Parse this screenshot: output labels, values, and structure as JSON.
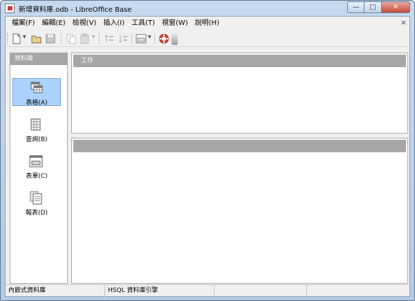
{
  "window": {
    "title": "新增資料庫.odb - LibreOffice Base",
    "minimize_glyph": "—",
    "maximize_glyph": "□",
    "close_glyph": "✕"
  },
  "menubar": {
    "items": [
      "檔案(F)",
      "編輯(E)",
      "檢視(V)",
      "插入(I)",
      "工具(T)",
      "視窗(W)",
      "說明(H)"
    ],
    "close_document_glyph": "×"
  },
  "toolbar": {
    "icons": [
      "new-document-icon",
      "open-folder-icon",
      "save-icon",
      "copy-icon",
      "paste-icon",
      "sort-ascending-icon",
      "sort-descending-icon",
      "form-icon",
      "help-lifebuoy-icon"
    ]
  },
  "sidebar": {
    "header": "資料庫",
    "items": [
      {
        "label": "表格(A)",
        "icon": "tables-icon",
        "selected": true
      },
      {
        "label": "查詢(B)",
        "icon": "queries-icon",
        "selected": false
      },
      {
        "label": "表單(C)",
        "icon": "forms-icon",
        "selected": false
      },
      {
        "label": "報表(D)",
        "icon": "reports-icon",
        "selected": false
      }
    ]
  },
  "tasks_panel": {
    "header": "工作"
  },
  "objects_panel": {
    "header": ""
  },
  "statusbar": {
    "cells": [
      "內嵌式資料庫",
      "HSQL 資料庫引擎",
      "",
      ""
    ]
  },
  "colors": {
    "selection": "#aad4fd",
    "header_gray": "#a6a6a6",
    "close_red": "#c7493a"
  }
}
